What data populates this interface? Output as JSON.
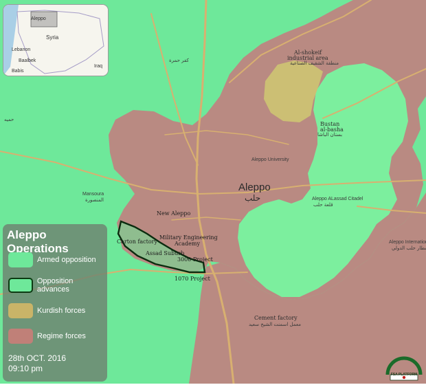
{
  "inset": {
    "labels": {
      "aleppo": "Aleppo",
      "syria": "Syria",
      "lebanon": "Lebanon",
      "iraq": "Iraq",
      "baalbek": "Baalbek",
      "babis": "Babis"
    }
  },
  "map_labels": {
    "alshokeif": "Al-shokeif",
    "industrial_area": "industrial area",
    "industrial_area_ar": "منطقة الشقيف الصناعية",
    "kafr_hamra_ar": "كفر حمرة",
    "city_en": "Aleppo",
    "city_ar": "حلب",
    "aleppo_university": "Aleppo University",
    "bustan_al_basha": "Bustan",
    "bustan_al_basha_2": "al-basha",
    "bustan_al_basha_ar": "بستان الباشا",
    "citadel": "Aleppo ALassad Citadel",
    "citadel_ar": "قلعة حلب",
    "airport": "Aleppo International",
    "airport_ar": "مطار حلب الدولي",
    "mansoura": "Mansoura",
    "mansoura_ar": "المنصورة",
    "cement_factory": "Cement factory",
    "cement_factory_ar": "معمل اسمنت الشيخ سعيد",
    "himmiyah_ar": "حميه",
    "new_aleppo": "New Aleppo",
    "carton_factory": "Carton factory",
    "military_academy_1": "Military Engineering",
    "military_academy_2": "Academy",
    "assad_suburb": "Assad Suburb",
    "project_3000": "3000 Project",
    "project_1070": "1070 Project"
  },
  "legend": {
    "title": "Aleppo Operations",
    "items": [
      {
        "label": "Armed opposition",
        "color": "#6ee89a"
      },
      {
        "label": "Opposition advances",
        "color": "#6ee89a",
        "border": "#0c3a12"
      },
      {
        "label": "Kurdish forces",
        "color": "#c9b468"
      },
      {
        "label": "Regime forces",
        "color": "#c08078"
      }
    ],
    "date": "28th OCT. 2016",
    "time": "09:10  pm"
  },
  "logo": {
    "text": "FSA PLATFORM"
  },
  "colors": {
    "opposition": "#6ee89a",
    "regime": "#b98a82",
    "kurdish": "#ccbf74",
    "advance_border": "#0b2c0f",
    "road": "#d8b070"
  }
}
